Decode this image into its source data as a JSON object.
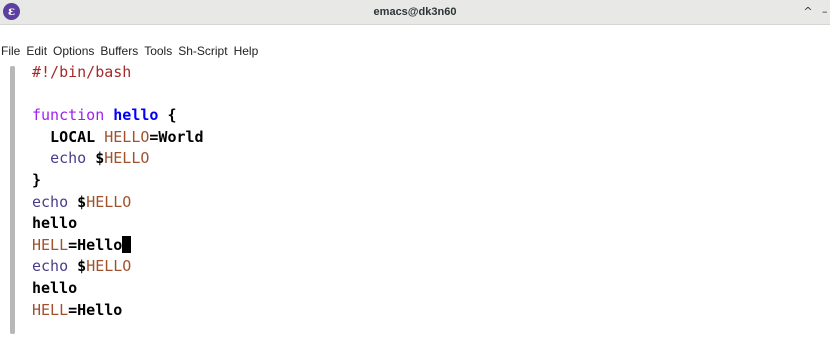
{
  "window": {
    "title": "emacs@dk3n60",
    "app_icon": "ε",
    "maximize_label": "^",
    "minimize_label": "–"
  },
  "menu": [
    "File",
    "Edit",
    "Options",
    "Buffers",
    "Tools",
    "Sh-Script",
    "Help"
  ],
  "buffer": {
    "lines": [
      [
        {
          "t": "#!/bin/bash",
          "c": "comment"
        }
      ],
      [],
      [
        {
          "t": "function",
          "c": "keyword"
        },
        {
          "t": " ",
          "c": "plain"
        },
        {
          "t": "hello",
          "c": "func"
        },
        {
          "t": " {",
          "c": "plain"
        }
      ],
      [
        {
          "t": "  LOCAL ",
          "c": "plain"
        },
        {
          "t": "HELLO",
          "c": "var"
        },
        {
          "t": "=World",
          "c": "plain"
        }
      ],
      [
        {
          "t": "  ",
          "c": "plain"
        },
        {
          "t": "echo",
          "c": "builtin"
        },
        {
          "t": " $",
          "c": "plain"
        },
        {
          "t": "HELLO",
          "c": "var"
        }
      ],
      [
        {
          "t": "}",
          "c": "plain"
        }
      ],
      [
        {
          "t": "echo",
          "c": "builtin"
        },
        {
          "t": " $",
          "c": "plain"
        },
        {
          "t": "HELLO",
          "c": "var"
        }
      ],
      [
        {
          "t": "hello",
          "c": "plain"
        }
      ],
      [
        {
          "t": "HELL",
          "c": "var"
        },
        {
          "t": "=Hello",
          "c": "plain"
        },
        {
          "cursor": true
        }
      ],
      [
        {
          "t": "echo",
          "c": "builtin"
        },
        {
          "t": " $",
          "c": "plain"
        },
        {
          "t": "HELLO",
          "c": "var"
        }
      ],
      [
        {
          "t": "hello",
          "c": "plain"
        }
      ],
      [
        {
          "t": "HELL",
          "c": "var"
        },
        {
          "t": "=Hello",
          "c": "plain"
        }
      ]
    ]
  },
  "colors": {
    "comment": "#a52a2a",
    "keyword": "#a020f0",
    "function_name": "#0000ff",
    "variable": "#a0522d",
    "builtin": "#483d8b",
    "app_icon_bg": "#5c3f9e"
  }
}
